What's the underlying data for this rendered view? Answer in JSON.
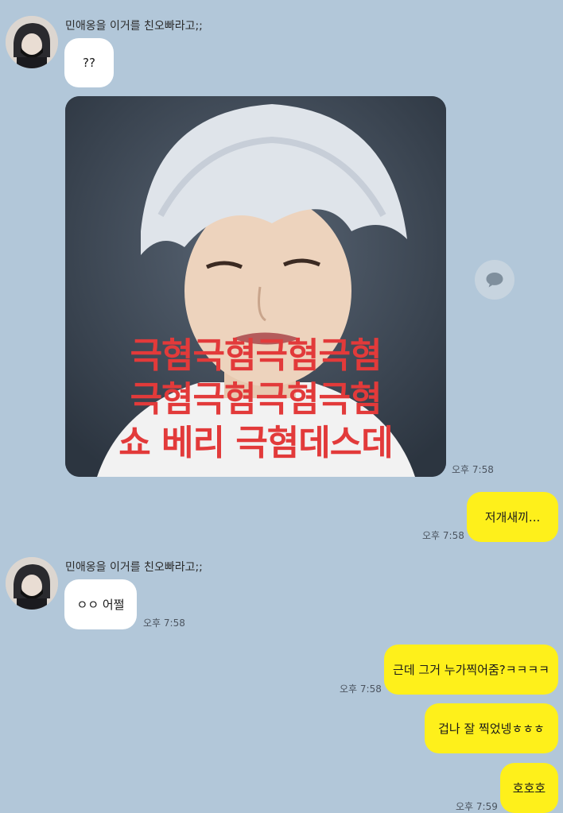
{
  "chat": {
    "sender_name": "민애옹을 이거를 친오빠라고;;",
    "group1": {
      "bubble_text": "??",
      "photo_caption_lines": [
        "극혐극혐극혐극혐",
        "극혐극혐극혐극혐",
        "쇼 베리 극혐데스데"
      ],
      "time": "오후 7:58"
    },
    "out1": {
      "text": "저개새끼...",
      "time": "오후 7:58"
    },
    "group2": {
      "bubble_text": "ㅇㅇ 어쩔",
      "time": "오후 7:58"
    },
    "out2": {
      "messages": [
        {
          "text": "근데 그거 누가찍어줌?ㅋㅋㅋㅋ",
          "time": "오후 7:58"
        },
        {
          "text": "겁나 잘 찍었넹ㅎㅎㅎ"
        },
        {
          "text": "호호호",
          "time": "오후 7:59"
        }
      ]
    }
  },
  "icons": {
    "share": "speech-bubble-icon"
  },
  "colors": {
    "background": "#b2c7d9",
    "incoming_bubble": "#ffffff",
    "outgoing_bubble": "#fef01b",
    "caption": "#e23a3a"
  }
}
